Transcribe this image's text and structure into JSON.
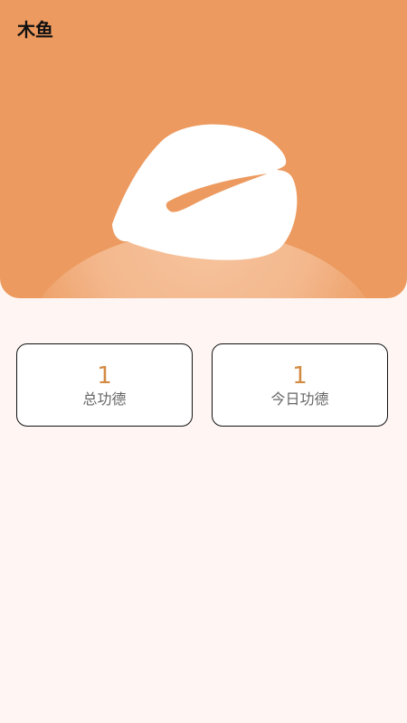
{
  "app": {
    "title": "木鱼"
  },
  "hero": {
    "icon_name": "wooden-fish-icon",
    "colors": {
      "background": "#ec9a5f",
      "fish": "#ffffff",
      "glow": "#f6c49c"
    }
  },
  "stats": {
    "total": {
      "value": "1",
      "label": "总功德"
    },
    "today": {
      "value": "1",
      "label": "今日功德"
    }
  },
  "colors": {
    "page_background": "#fff6f3",
    "accent": "#d38a43",
    "card_border": "#111111",
    "label": "#666666"
  }
}
